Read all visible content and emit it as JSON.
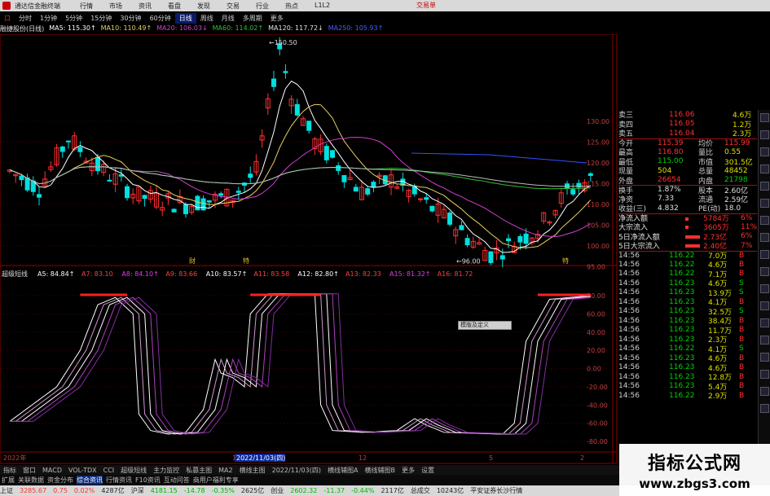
{
  "titlebar": {
    "app_title": "通达信金融终端",
    "menu": [
      "行情",
      "市场",
      "资讯",
      "看盘",
      "发现",
      "交易",
      "行业",
      "热点",
      "L1L2"
    ],
    "trade_label": "交易单"
  },
  "period_tabs": [
    "口",
    "分时",
    "1分钟",
    "5分钟",
    "15分钟",
    "30分钟",
    "60分钟",
    "日线",
    "周线",
    "月线",
    "多周期",
    "更多"
  ],
  "active_period": "日线",
  "ma_legend": {
    "stock": "融捷股份(日线)",
    "items": [
      {
        "label": "MA5: 115.30↑",
        "color": "#ffffff"
      },
      {
        "label": "MA10: 110.49↑",
        "color": "#e8d060"
      },
      {
        "label": "MA20: 106.03↓",
        "color": "#d040d0"
      },
      {
        "label": "MA60: 114.02↑",
        "color": "#30c030"
      },
      {
        "label": "MA120: 117.72↓",
        "color": "#e0e0e0"
      },
      {
        "label": "MA250: 105.93↑",
        "color": "#4060ff"
      }
    ]
  },
  "colors": {
    "up": "#ff3030",
    "down": "#00e0e0",
    "grid": "#8b0000"
  },
  "main_chart": {
    "y_ticks": [
      "130.00",
      "125.00",
      "120.00",
      "115.00",
      "110.00",
      "105.00",
      "100.00",
      "95.00"
    ],
    "annotations": {
      "high": "150.50",
      "low": "96.00"
    },
    "markers": [
      "财",
      "特",
      "特"
    ]
  },
  "indicator": {
    "name": "超级短线",
    "legend": [
      {
        "label": "A5: 84.84↑",
        "color": "#ffffff"
      },
      {
        "label": "A7: 83.10",
        "color": "#ff4040"
      },
      {
        "label": "A8: 84.10↑",
        "color": "#e040e0"
      },
      {
        "label": "A9: 83.66",
        "color": "#ff4040"
      },
      {
        "label": "A10: 83.57↑",
        "color": "#ffffff"
      },
      {
        "label": "A11: 83.58",
        "color": "#ff4040"
      },
      {
        "label": "A12: 82.80↑",
        "color": "#ffffff"
      },
      {
        "label": "A13: 82.33",
        "color": "#ff4040"
      },
      {
        "label": "A15: 81.32↑",
        "color": "#e040e0"
      },
      {
        "label": "A16: 81.72",
        "color": "#ff4040"
      }
    ],
    "y_ticks": [
      "80.00",
      "60.00",
      "40.00",
      "20.00",
      "0.00",
      "-20.00",
      "-40.00",
      "-60.00",
      "-80.00"
    ]
  },
  "x_axis": {
    "labels": [
      "2022年",
      "11",
      "2022/11/03(四)",
      "12",
      "5",
      "2"
    ]
  },
  "popup": {
    "text": "模版及定义"
  },
  "order_book": {
    "asks": [
      {
        "label": "卖三",
        "price": "116.06",
        "vol": "4.6万"
      },
      {
        "label": "卖四",
        "price": "116.05",
        "vol": "1.2万"
      },
      {
        "label": "卖五",
        "price": "116.04",
        "vol": "2.3万"
      }
    ],
    "stats": [
      [
        "今开",
        "115.39",
        "均价",
        "115.99"
      ],
      [
        "最高",
        "116.80",
        "量比",
        "0.55"
      ],
      [
        "最低",
        "115.00",
        "市值",
        "301.5亿"
      ],
      [
        "现量",
        "504",
        "总量",
        "48452"
      ],
      [
        "外盘",
        "26654",
        "内盘",
        "21798"
      ]
    ],
    "fund": [
      [
        "换手",
        "1.87%",
        "股本",
        "2.60亿"
      ],
      [
        "净资",
        "7.33",
        "流通",
        "2.59亿"
      ],
      [
        "收益(三)",
        "4.832",
        "PE(动)",
        "18.0"
      ]
    ],
    "flows": [
      {
        "label": "净流入额",
        "value": "5784万",
        "pct": "6%"
      },
      {
        "label": "大宗流入",
        "value": "3605万",
        "pct": "11%"
      },
      {
        "label": "5日净流入额",
        "value": "2.73亿",
        "pct": "6%"
      },
      {
        "label": "5日大宗流入",
        "value": "2.40亿",
        "pct": "7%"
      }
    ],
    "ticks": [
      {
        "time": "14:56",
        "price": "116.22",
        "vol": "7.0万",
        "side": "B"
      },
      {
        "time": "14:56",
        "price": "116.22",
        "vol": "4.6万",
        "side": "B"
      },
      {
        "time": "14:56",
        "price": "116.22",
        "vol": "7.1万",
        "side": "B"
      },
      {
        "time": "14:56",
        "price": "116.23",
        "vol": "4.6万",
        "side": "S"
      },
      {
        "time": "14:56",
        "price": "116.23",
        "vol": "13.9万",
        "side": "S"
      },
      {
        "time": "14:56",
        "price": "116.23",
        "vol": "4.1万",
        "side": "B"
      },
      {
        "time": "14:56",
        "price": "116.23",
        "vol": "32.5万",
        "side": "S"
      },
      {
        "time": "14:56",
        "price": "116.23",
        "vol": "38.4万",
        "side": "B"
      },
      {
        "time": "14:56",
        "price": "116.23",
        "vol": "11.7万",
        "side": "B"
      },
      {
        "time": "14:56",
        "price": "116.23",
        "vol": "2.3万",
        "side": "B"
      },
      {
        "time": "14:56",
        "price": "116.22",
        "vol": "4.1万",
        "side": "S"
      },
      {
        "time": "14:56",
        "price": "116.23",
        "vol": "4.6万",
        "side": "B"
      },
      {
        "time": "14:56",
        "price": "116.23",
        "vol": "4.6万",
        "side": "B"
      },
      {
        "time": "14:56",
        "price": "116.23",
        "vol": "12.8万",
        "side": "B"
      },
      {
        "time": "14:56",
        "price": "116.23",
        "vol": "5.4万",
        "side": "B"
      },
      {
        "time": "14:56",
        "price": "116.22",
        "vol": "2.9万",
        "side": "B"
      }
    ]
  },
  "indicator_tabs": [
    "指标",
    "窗口",
    "MACD",
    "VOL-TDX",
    "CCI",
    "超级短线",
    "主力监控",
    "私募主图",
    "MA2",
    "横线主图",
    "2022/11/03(四)",
    "横线辅图A",
    "横线辅图B",
    "更多",
    "设置"
  ],
  "main_tabs": [
    "扩展",
    "关联数据",
    "资金分布",
    "综合资讯",
    "行情资讯",
    "F10资讯",
    "互动问答",
    "商用户福利专享"
  ],
  "active_main_tab": "综合资讯",
  "statusbar": [
    {
      "text": "上证",
      "cls": ""
    },
    {
      "text": "3285.67",
      "cls": "up"
    },
    {
      "text": "0.75",
      "cls": "up"
    },
    {
      "text": "0.02%",
      "cls": "up"
    },
    {
      "text": "4287亿",
      "cls": ""
    },
    {
      "text": "沪深",
      "cls": ""
    },
    {
      "text": "4181.15",
      "cls": "dn"
    },
    {
      "text": "-14.78",
      "cls": "dn"
    },
    {
      "text": "-0.35%",
      "cls": "dn"
    },
    {
      "text": "2625亿",
      "cls": ""
    },
    {
      "text": "创业",
      "cls": ""
    },
    {
      "text": "2602.32",
      "cls": "dn"
    },
    {
      "text": "-11.37",
      "cls": "dn"
    },
    {
      "text": "-0.44%",
      "cls": "dn"
    },
    {
      "text": "2117亿",
      "cls": ""
    },
    {
      "text": "总成交",
      "cls": ""
    },
    {
      "text": "10243亿",
      "cls": ""
    },
    {
      "text": "平安证券长沙行情",
      "cls": ""
    }
  ],
  "watermark": {
    "title": "指标公式网",
    "url": "www.zbgs3.com"
  }
}
